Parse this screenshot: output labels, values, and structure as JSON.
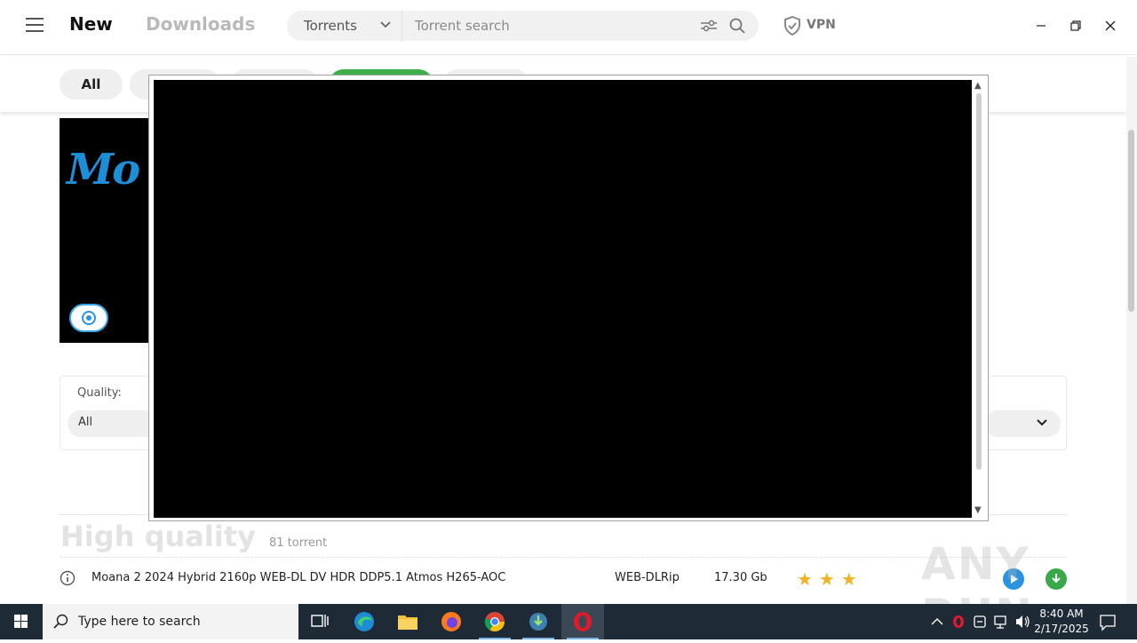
{
  "header": {
    "nav_new": "New",
    "nav_downloads": "Downloads",
    "search_type": "Torrents",
    "search_placeholder": "Torrent search",
    "vpn_label": "VPN"
  },
  "tabs": [
    {
      "label": "All",
      "active": true
    },
    {
      "label": ""
    },
    {
      "label": ""
    },
    {
      "label": "",
      "color": "#3dae49"
    },
    {
      "label": ""
    }
  ],
  "filters": {
    "quality_label": "Quality:",
    "quality_value": "All"
  },
  "section": {
    "title": "High quality",
    "count": "81 torrent"
  },
  "torrents": [
    {
      "name": "Moana 2 2024 Hybrid 2160p WEB-DL DV HDR DDP5.1 Atmos H265-AOC",
      "type": "WEB-DLRip",
      "size": "17.30 Gb",
      "rating_stars": 3
    }
  ],
  "poster": {
    "logo_text": "Mo"
  },
  "watermark": "ANY RUN",
  "taskbar": {
    "search_placeholder": "Type here to search",
    "time": "8:40 AM",
    "date": "2/17/2025"
  },
  "colors": {
    "accent_green": "#3dae49",
    "accent_blue": "#2a93e0",
    "star": "#f0b323",
    "taskbar": "#1f2a37"
  }
}
